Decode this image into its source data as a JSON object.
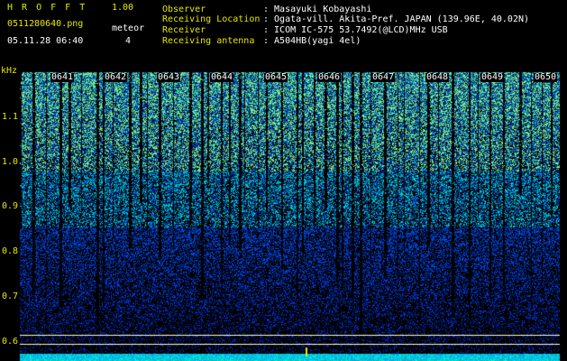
{
  "app": {
    "name": "H R O F F T",
    "version": "1.00",
    "filename": "0511280640.png",
    "datetime": "05.11.28 06:40",
    "meteor_label": "meteor",
    "meteor_count": "4"
  },
  "info": [
    {
      "label": "Observer",
      "value": ": Masayuki Kobayashi"
    },
    {
      "label": "Receiving Location",
      "value": ": Ogata-vill. Akita-Pref. JAPAN (139.96E, 40.02N)"
    },
    {
      "label": "Receiver",
      "value": ": ICOM IC-575 53.7492(@LCD)MHz USB"
    },
    {
      "label": "Receiving antenna",
      "value": ": A504HB(yagi 4el)"
    }
  ],
  "axis": {
    "unit": "kHz",
    "ticks": [
      "1.1",
      "1.0",
      "0.9",
      "0.8",
      "0.7",
      "0.6"
    ]
  },
  "time_labels": [
    "0641",
    "0642",
    "0643",
    "0644",
    "0645",
    "0646",
    "0647",
    "0648",
    "0649",
    "0650"
  ],
  "colors": {
    "label": "#e6e600",
    "value": "#00e6e6",
    "text": "#ffffff",
    "background": "#000000"
  }
}
